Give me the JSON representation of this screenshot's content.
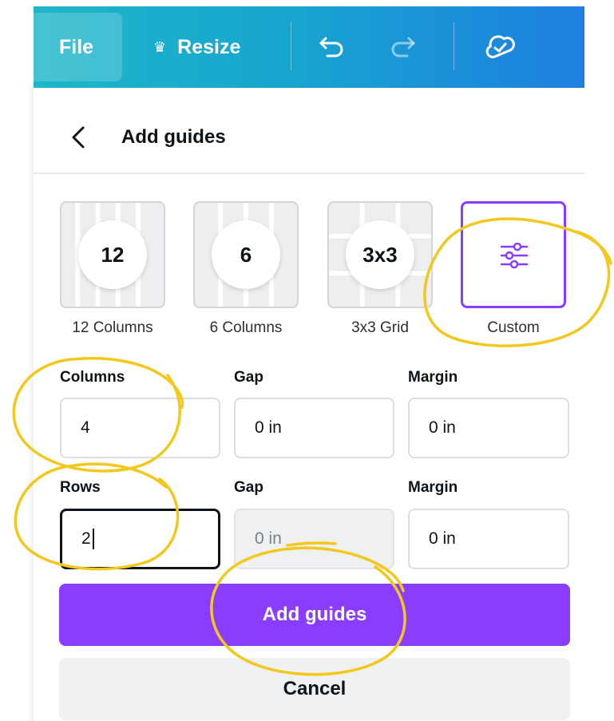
{
  "topbar": {
    "file_label": "File",
    "resize_label": "Resize",
    "icons": [
      "crown-icon",
      "undo-icon",
      "redo-icon",
      "cloud-check-icon"
    ],
    "gradient": [
      "#1eb6c9",
      "#1e7fe0"
    ]
  },
  "panel": {
    "title": "Add guides",
    "presets": [
      {
        "badge": "12",
        "label": "12 Columns"
      },
      {
        "badge": "6",
        "label": "6 Columns"
      },
      {
        "badge": "3x3",
        "label": "3x3 Grid"
      },
      {
        "badge": "",
        "label": "Custom",
        "icon": "sliders-icon",
        "selected": true
      }
    ],
    "columns": {
      "label": "Columns",
      "value": "4",
      "gap_label": "Gap",
      "gap_value": "0 in",
      "margin_label": "Margin",
      "margin_value": "0 in"
    },
    "rows": {
      "label": "Rows",
      "value": "2",
      "gap_label": "Gap",
      "gap_value": "0 in",
      "margin_label": "Margin",
      "margin_value": "0 in"
    },
    "add_button": "Add guides",
    "cancel_button": "Cancel"
  },
  "colors": {
    "accent": "#8b3dff",
    "annotation": "#f2c81c"
  }
}
